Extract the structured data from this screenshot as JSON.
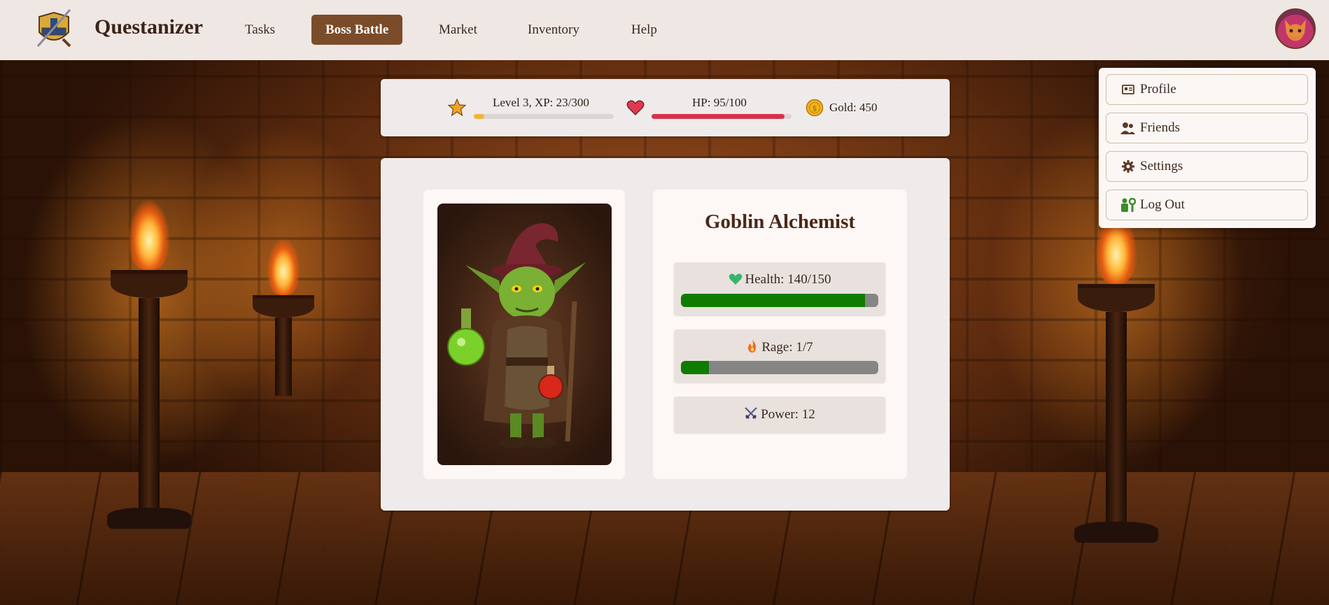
{
  "app": {
    "title": "Questanizer"
  },
  "nav": {
    "items": [
      {
        "label": "Tasks",
        "active": false
      },
      {
        "label": "Boss Battle",
        "active": true
      },
      {
        "label": "Market",
        "active": false
      },
      {
        "label": "Inventory",
        "active": false
      },
      {
        "label": "Help",
        "active": false
      }
    ]
  },
  "user_menu": {
    "items": [
      {
        "label": "Profile",
        "icon": "id-card-icon"
      },
      {
        "label": "Friends",
        "icon": "friends-icon"
      },
      {
        "label": "Settings",
        "icon": "gear-icon"
      },
      {
        "label": "Log Out",
        "icon": "logout-icon"
      }
    ]
  },
  "player": {
    "level_text": "Level 3, XP: 23/300",
    "xp": 23,
    "xp_max": 300,
    "hp_text": "HP: 95/100",
    "hp": 95,
    "hp_max": 100,
    "gold_text": "Gold: 450"
  },
  "boss": {
    "name": "Goblin Alchemist",
    "health_text": "Health: 140/150",
    "health": 140,
    "health_max": 150,
    "rage_text": "Rage: 1/7",
    "rage": 1,
    "rage_max": 7,
    "power_text": "Power: 12"
  },
  "colors": {
    "accent": "#7b4c2a",
    "xp_bar": "#f2b534",
    "hp_bar": "#d7334a",
    "boss_bar": "#0f7c00",
    "bar_track": "#858585"
  }
}
